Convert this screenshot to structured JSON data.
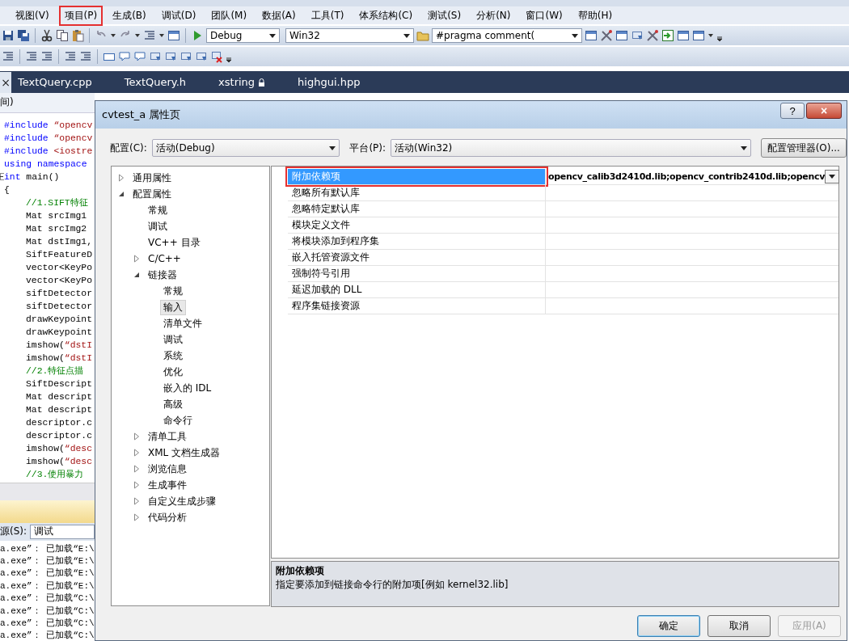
{
  "menu_bar": [
    {
      "label": "视图(V)",
      "marked": false
    },
    {
      "label": "项目(P)",
      "marked": true
    },
    {
      "label": "生成(B)",
      "marked": false
    },
    {
      "label": "调试(D)",
      "marked": false
    },
    {
      "label": "团队(M)",
      "marked": false
    },
    {
      "label": "数据(A)",
      "marked": false
    },
    {
      "label": "工具(T)",
      "marked": false
    },
    {
      "label": "体系结构(C)",
      "marked": false
    },
    {
      "label": "测试(S)",
      "marked": false
    },
    {
      "label": "分析(N)",
      "marked": false
    },
    {
      "label": "窗口(W)",
      "marked": false
    },
    {
      "label": "帮助(H)",
      "marked": false
    }
  ],
  "toolbar": {
    "configuration": "Debug",
    "platform": "Win32",
    "find": "#pragma comment("
  },
  "tab_close": "×",
  "tabs": [
    {
      "label": "TextQuery.cpp",
      "locked": false
    },
    {
      "label": "TextQuery.h",
      "locked": false
    },
    {
      "label": "xstring",
      "locked": true
    },
    {
      "label": "highgui.hpp",
      "locked": false
    }
  ],
  "editor": {
    "scope": "间)",
    "lines": [
      {
        "indent": false,
        "fold": false,
        "segments": [
          {
            "kind": "kw",
            "text": "#include"
          },
          {
            "kind": "str",
            "text": " “opencv"
          }
        ]
      },
      {
        "indent": false,
        "fold": false,
        "segments": [
          {
            "kind": "kw",
            "text": "#include"
          },
          {
            "kind": "str",
            "text": " “opencv"
          }
        ]
      },
      {
        "indent": false,
        "fold": false,
        "segments": [
          {
            "kind": "kw",
            "text": "#include"
          },
          {
            "kind": "str",
            "text": " <iostre"
          }
        ]
      },
      {
        "indent": false,
        "fold": false,
        "segments": [
          {
            "kind": "kw",
            "text": "using namespace"
          }
        ]
      },
      {
        "indent": false,
        "fold": true,
        "segments": [
          {
            "kind": "kw",
            "text": "int"
          },
          {
            "kind": "plain",
            "text": " main()"
          }
        ]
      },
      {
        "indent": false,
        "fold": false,
        "segments": [
          {
            "kind": "plain",
            "text": "{"
          }
        ]
      },
      {
        "indent": true,
        "fold": false,
        "segments": [
          {
            "kind": "cmt",
            "text": "//1.SIFT特征"
          }
        ]
      },
      {
        "indent": true,
        "fold": false,
        "segments": [
          {
            "kind": "plain",
            "text": "Mat srcImg1"
          }
        ]
      },
      {
        "indent": true,
        "fold": false,
        "segments": [
          {
            "kind": "plain",
            "text": "Mat srcImg2"
          }
        ]
      },
      {
        "indent": true,
        "fold": false,
        "segments": [
          {
            "kind": "plain",
            "text": "Mat dstImg1,"
          }
        ]
      },
      {
        "indent": true,
        "fold": false,
        "segments": [
          {
            "kind": "plain",
            "text": "SiftFeatureD"
          }
        ]
      },
      {
        "indent": true,
        "fold": false,
        "segments": [
          {
            "kind": "plain",
            "text": "vector<KeyPo"
          }
        ]
      },
      {
        "indent": true,
        "fold": false,
        "segments": [
          {
            "kind": "plain",
            "text": "vector<KeyPo"
          }
        ]
      },
      {
        "indent": true,
        "fold": false,
        "segments": [
          {
            "kind": "plain",
            "text": "siftDetector"
          }
        ]
      },
      {
        "indent": true,
        "fold": false,
        "segments": [
          {
            "kind": "plain",
            "text": "siftDetector"
          }
        ]
      },
      {
        "indent": true,
        "fold": false,
        "segments": [
          {
            "kind": "plain",
            "text": "drawKeypoint"
          }
        ]
      },
      {
        "indent": true,
        "fold": false,
        "segments": [
          {
            "kind": "plain",
            "text": "drawKeypoint"
          }
        ]
      },
      {
        "indent": true,
        "fold": false,
        "segments": [
          {
            "kind": "plain",
            "text": "imshow("
          },
          {
            "kind": "str",
            "text": "“dstI"
          }
        ]
      },
      {
        "indent": true,
        "fold": false,
        "segments": [
          {
            "kind": "plain",
            "text": "imshow("
          },
          {
            "kind": "str",
            "text": "“dstI"
          }
        ]
      },
      {
        "indent": true,
        "fold": false,
        "segments": [
          {
            "kind": "cmt",
            "text": "//2.特征点描"
          }
        ]
      },
      {
        "indent": true,
        "fold": false,
        "segments": [
          {
            "kind": "plain",
            "text": "SiftDescript"
          }
        ]
      },
      {
        "indent": true,
        "fold": false,
        "segments": [
          {
            "kind": "plain",
            "text": "Mat descript"
          }
        ]
      },
      {
        "indent": true,
        "fold": false,
        "segments": [
          {
            "kind": "plain",
            "text": "Mat descript"
          }
        ]
      },
      {
        "indent": true,
        "fold": false,
        "segments": [
          {
            "kind": "plain",
            "text": "descriptor.c"
          }
        ]
      },
      {
        "indent": true,
        "fold": false,
        "segments": [
          {
            "kind": "plain",
            "text": "descriptor.c"
          }
        ]
      },
      {
        "indent": true,
        "fold": false,
        "segments": [
          {
            "kind": "plain",
            "text": "imshow("
          },
          {
            "kind": "str",
            "text": "“desc"
          }
        ]
      },
      {
        "indent": true,
        "fold": false,
        "segments": [
          {
            "kind": "plain",
            "text": "imshow("
          },
          {
            "kind": "str",
            "text": "“desc"
          }
        ]
      },
      {
        "indent": true,
        "fold": false,
        "segments": [
          {
            "kind": "cmt",
            "text": "//3.使用暴力"
          }
        ]
      }
    ]
  },
  "output": {
    "source_label": "源(S):",
    "source": "调试",
    "lines": [
      "a.exe”： 已加载“E:\\",
      "a.exe”： 已加载“E:\\",
      "a.exe”： 已加载“E:\\",
      "a.exe”： 已加载“E:\\",
      "a.exe”： 已加载“C:\\",
      "a.exe”： 已加载“C:\\",
      "a.exe”： 已加载“C:\\",
      "a.exe”： 已加载“C:\\"
    ]
  },
  "dialog": {
    "title": "cvtest_a 属性页",
    "help": "?",
    "close": "×",
    "config_label": "配置(C):",
    "config": "活动(Debug)",
    "platform_label": "平台(P):",
    "platform": "活动(Win32)",
    "manager_button": "配置管理器(O)...",
    "tree": [
      {
        "label": "通用属性",
        "expanded": false,
        "selected": false
      },
      {
        "label": "配置属性",
        "expanded": true,
        "selected": false,
        "children": [
          {
            "label": "常规",
            "selected": false
          },
          {
            "label": "调试",
            "selected": false
          },
          {
            "label": "VC++ 目录",
            "selected": false
          },
          {
            "label": "C/C++",
            "expanded": false,
            "selected": false
          },
          {
            "label": "链接器",
            "expanded": true,
            "selected": false,
            "children": [
              {
                "label": "常规",
                "selected": false
              },
              {
                "label": "输入",
                "selected": true
              },
              {
                "label": "清单文件",
                "selected": false
              },
              {
                "label": "调试",
                "selected": false
              },
              {
                "label": "系统",
                "selected": false
              },
              {
                "label": "优化",
                "selected": false
              },
              {
                "label": "嵌入的 IDL",
                "selected": false
              },
              {
                "label": "高级",
                "selected": false
              },
              {
                "label": "命令行",
                "selected": false
              }
            ]
          },
          {
            "label": "清单工具",
            "expanded": false,
            "selected": false
          },
          {
            "label": "XML 文档生成器",
            "expanded": false,
            "selected": false
          },
          {
            "label": "浏览信息",
            "expanded": false,
            "selected": false
          },
          {
            "label": "生成事件",
            "expanded": false,
            "selected": false
          },
          {
            "label": "自定义生成步骤",
            "expanded": false,
            "selected": false
          },
          {
            "label": "代码分析",
            "expanded": false,
            "selected": false
          }
        ]
      }
    ],
    "properties": [
      {
        "name": "附加依赖项",
        "value": "opencv_calib3d2410d.lib;opencv_contrib2410d.lib;opencv",
        "selected": true,
        "marked": true
      },
      {
        "name": "忽略所有默认库",
        "selected": false,
        "marked": false
      },
      {
        "name": "忽略特定默认库",
        "selected": false,
        "marked": false
      },
      {
        "name": "模块定义文件",
        "selected": false,
        "marked": false
      },
      {
        "name": "将模块添加到程序集",
        "selected": false,
        "marked": false
      },
      {
        "name": "嵌入托管资源文件",
        "selected": false,
        "marked": false
      },
      {
        "name": "强制符号引用",
        "selected": false,
        "marked": false
      },
      {
        "name": "延迟加载的 DLL",
        "selected": false,
        "marked": false
      },
      {
        "name": "程序集链接资源",
        "selected": false,
        "marked": false
      }
    ],
    "description": {
      "title": "附加依赖项",
      "text": "指定要添加到链接命令行的附加项[例如 kernel32.lib]"
    },
    "buttons": [
      {
        "label": "确定",
        "kind": "default",
        "disabled": false
      },
      {
        "label": "取消",
        "kind": "normal",
        "disabled": false
      },
      {
        "label": "应用(A)",
        "kind": "normal",
        "disabled": true
      }
    ]
  }
}
